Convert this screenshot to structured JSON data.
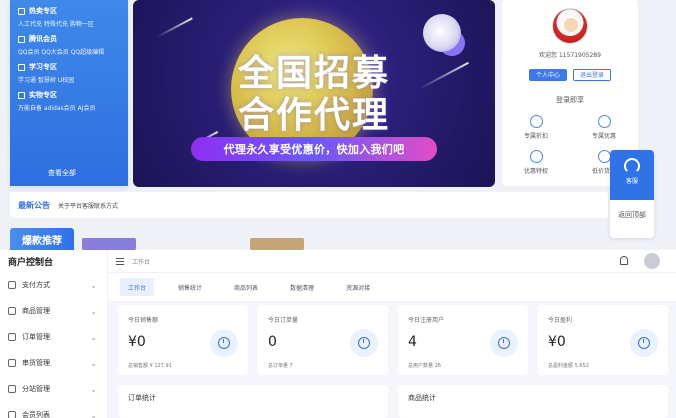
{
  "storefront": {
    "left_menu": [
      {
        "title": "热卖专区",
        "sub": "人工代充  特殊代充  购物一区"
      },
      {
        "title": "腾讯会员",
        "sub": "QQ会员  QQ大会员  QQ超级编辑"
      },
      {
        "title": "学习专区",
        "sub": "学习通  智慧树  U校园"
      },
      {
        "title": "实物专区",
        "sub": "万能自备  adidas会员  AJ会员"
      }
    ],
    "view_all": "查看全部",
    "hero": {
      "headline_line1": "全国招募",
      "headline_line2": "合作代理",
      "cta_text": "代理永久享受优惠价，快加入我们吧"
    },
    "user_card": {
      "welcome": "欢迎您 11571905289",
      "btn_center": "个人中心",
      "btn_logout": "退出登录",
      "section_title": "登录即享",
      "shortcuts": [
        "专属折扣",
        "专属优惠",
        "优惠特权",
        "低价货源"
      ]
    },
    "float_tools": {
      "support": "客服",
      "back_top": "返回顶部"
    },
    "notice": {
      "tag": "最新公告",
      "text": "关于平台客服联系方式"
    },
    "category_chip": "爆款推荐"
  },
  "console": {
    "title": "商户控制台",
    "menu": [
      {
        "label": "支付方式"
      },
      {
        "label": "商品管理"
      },
      {
        "label": "订单管理"
      },
      {
        "label": "串货管理"
      },
      {
        "label": "分站管理"
      },
      {
        "label": "会员列表"
      }
    ],
    "breadcrumb": "工作台",
    "tabs": [
      {
        "label": "工作台",
        "active": true
      },
      {
        "label": "销售统计",
        "active": false
      },
      {
        "label": "商品列表",
        "active": false
      },
      {
        "label": "数据清理",
        "active": false
      },
      {
        "label": "资源对接",
        "active": false
      }
    ],
    "stats": [
      {
        "label": "今日销售额",
        "value": "¥0",
        "sub": "总销售额 ¥ 127.91"
      },
      {
        "label": "今日订单量",
        "value": "0",
        "sub": "总订单量 7"
      },
      {
        "label": "今日注册用户",
        "value": "4",
        "sub": "总用户数量 26"
      },
      {
        "label": "今日盈利",
        "value": "¥0",
        "sub": "总盈利金额 5.652"
      }
    ],
    "panels": {
      "order_stats": "订单统计",
      "goods_stats": "商品统计"
    }
  },
  "colors": {
    "brand_blue": "#2f73e7",
    "page_bg": "#f3f5f9"
  }
}
